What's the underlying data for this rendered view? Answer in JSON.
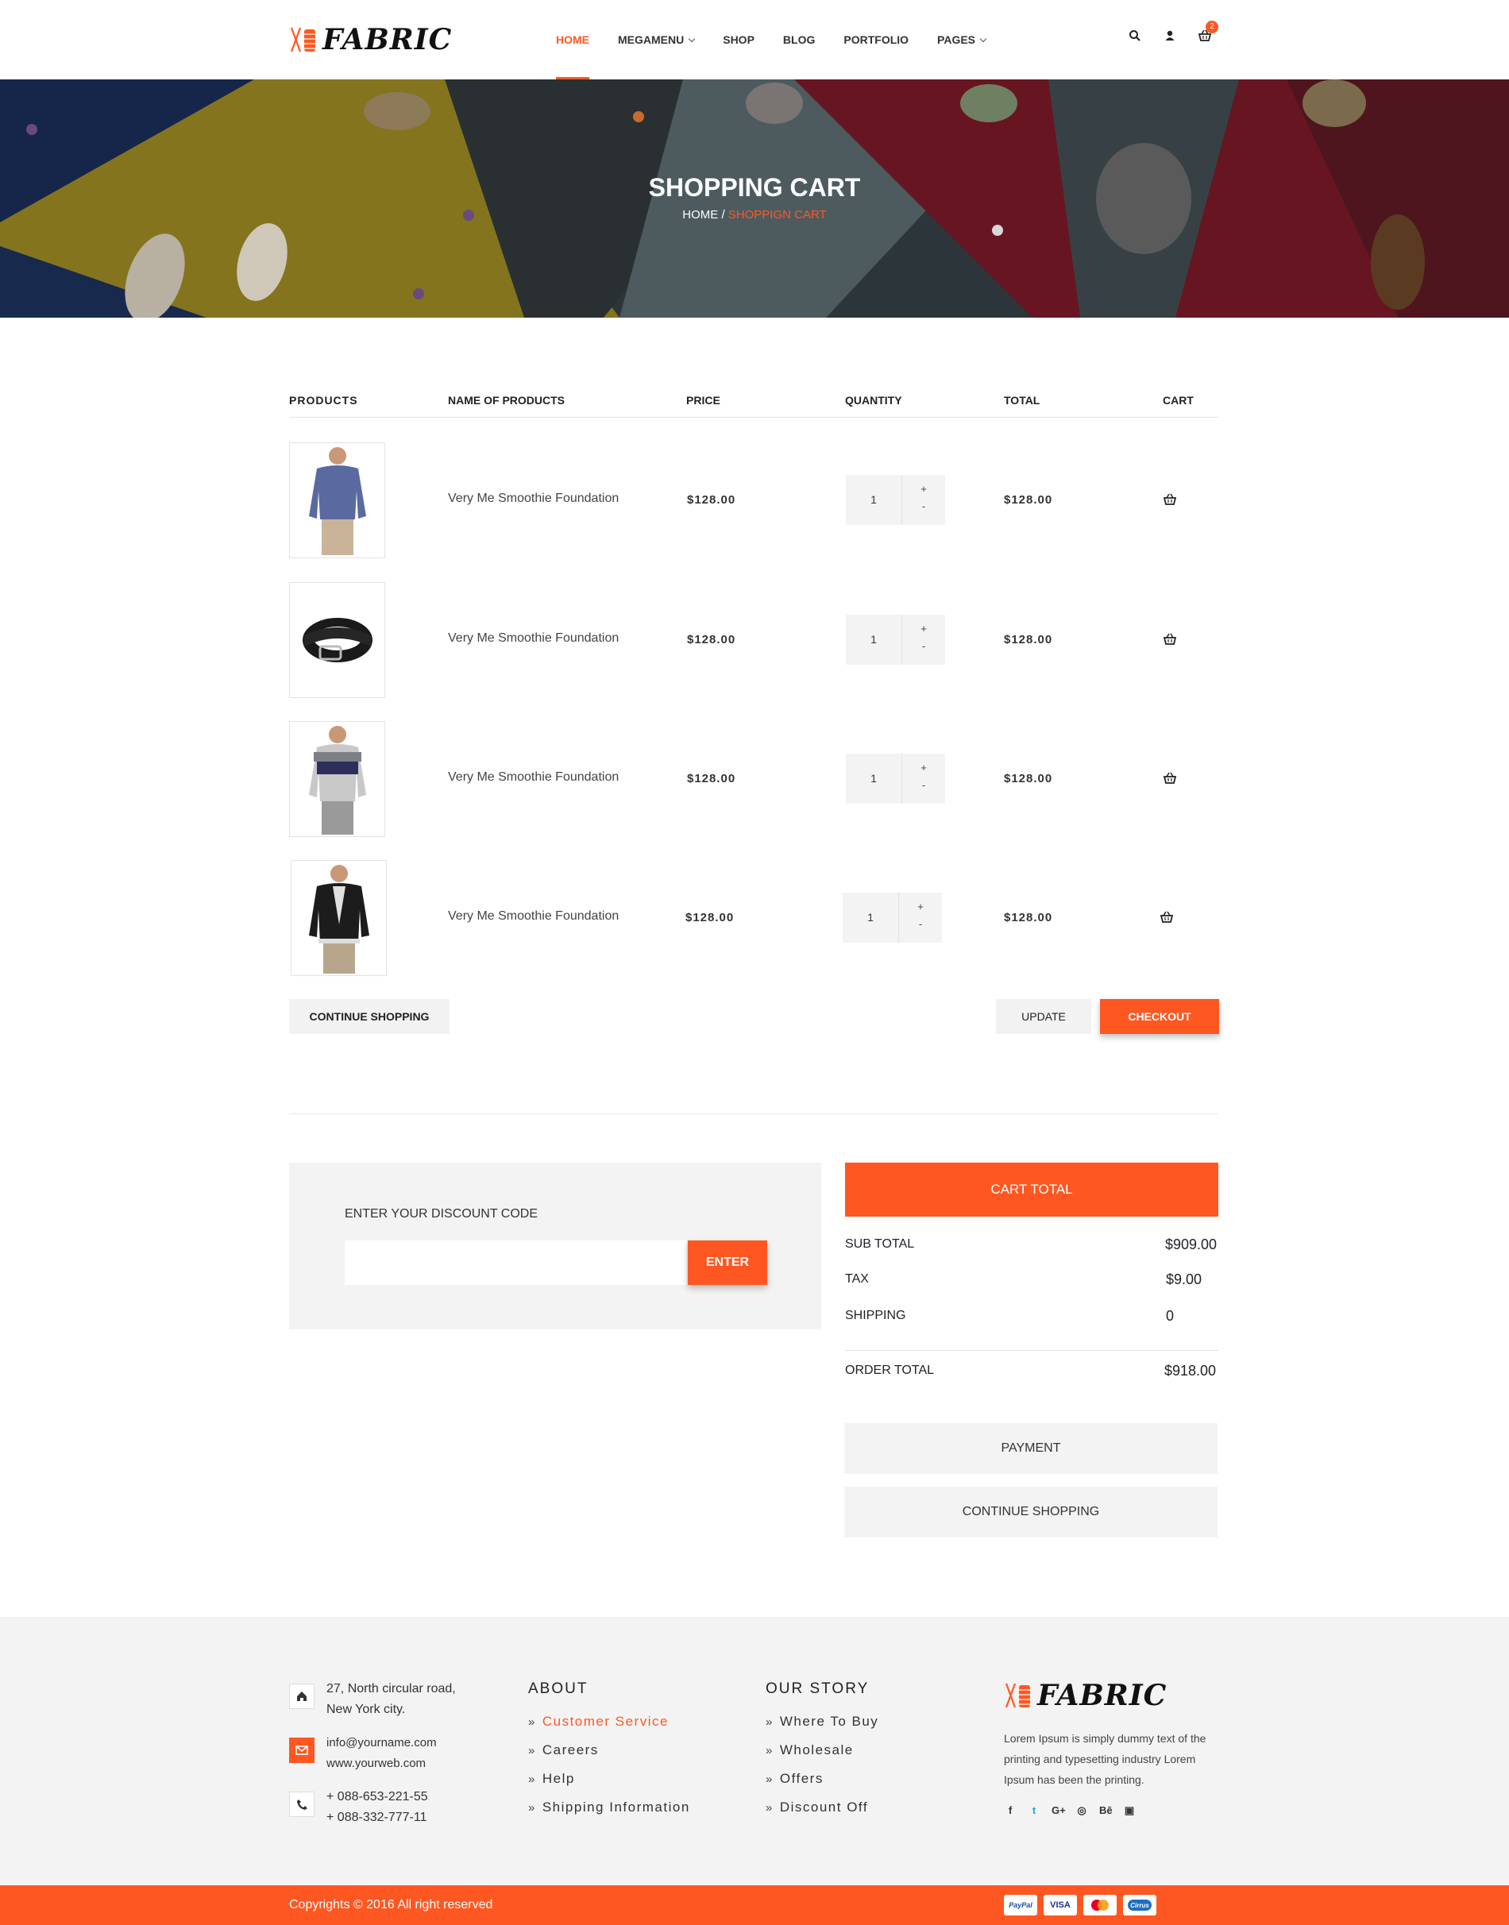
{
  "header": {
    "logo_text": "FABRIC",
    "nav": [
      "HOME",
      "MEGAMENU",
      "SHOP",
      "BLOG",
      "PORTFOLIO",
      "PAGES"
    ],
    "cart_count": "2",
    "icons": [
      "search-icon",
      "user-icon",
      "basket-icon"
    ]
  },
  "hero": {
    "title": "SHOPPING CART",
    "crumb_home": "HOME",
    "crumb_sep": " / ",
    "crumb_current": "SHOPPIGN CART"
  },
  "table": {
    "headers": [
      "PRODUCTS",
      "NAME OF PRODUCTS",
      "PRICE",
      "QUANTITY",
      "TOTAL",
      "CART"
    ],
    "rows": [
      {
        "image": "blue-sweater",
        "name": "Very Me Smoothie Foundation",
        "price": "$128.00",
        "qty": "1",
        "total": "$128.00"
      },
      {
        "image": "black-belt",
        "name": "Very Me Smoothie Foundation",
        "price": "$128.00",
        "qty": "1",
        "total": "$128.00"
      },
      {
        "image": "striped-sweater",
        "name": "Very Me Smoothie Foundation",
        "price": "$128.00",
        "qty": "1",
        "total": "$128.00"
      },
      {
        "image": "leather-jacket",
        "name": "Very Me Smoothie Foundation",
        "price": "$128.00",
        "qty": "1",
        "total": "$128.00"
      }
    ],
    "plus": "+",
    "minus": "-"
  },
  "actions": {
    "continue": "CONTINUE SHOPPING",
    "update": "UPDATE",
    "checkout": "CHECKOUT"
  },
  "discount": {
    "label": "ENTER YOUR DISCOUNT CODE",
    "value": "",
    "button": "ENTER"
  },
  "totals": {
    "title": "CART TOTAL",
    "sub_label": "SUB TOTAL",
    "sub_value": "$909.00",
    "tax_label": "TAX",
    "tax_value": "$9.00",
    "ship_label": "SHIPPING",
    "ship_value": "0",
    "order_label": "ORDER TOTAL",
    "order_value": "$918.00",
    "payment": "PAYMENT",
    "continue": "CONTINUE SHOPPING"
  },
  "footer": {
    "address1": "27, North circular road,",
    "address2": "New York city.",
    "email": "info@yourname.com",
    "web": "www.yourweb.com",
    "phone1": "+ 088-653-221-55",
    "phone2": "+ 088-332-777-11",
    "about_title": "ABOUT",
    "about_links": [
      "Customer Service",
      "Careers",
      "Help",
      "Shipping Information"
    ],
    "story_title": "OUR STORY",
    "story_links": [
      "Where To Buy",
      "Wholesale",
      "Offers",
      "Discount Off"
    ],
    "logo_text": "FABRIC",
    "desc": "Lorem Ipsum is simply dummy text of the printing and typesetting industry Lorem Ipsum has been the printing.",
    "social": [
      "f",
      "t",
      "G+",
      "dribbble",
      "Bē",
      "youtube"
    ],
    "copyright": "Copyrights © 2016 All right reserved",
    "cards": [
      "PayPal",
      "VISA",
      "MasterCard",
      "Cirrus"
    ]
  },
  "colors": {
    "accent": "#ff5722",
    "light_bg": "#f3f3f3"
  }
}
